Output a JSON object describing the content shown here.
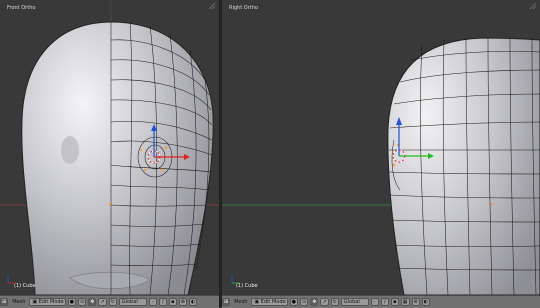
{
  "left_viewport": {
    "view_label": "Front Ortho",
    "object_label": "(1) Cube"
  },
  "right_viewport": {
    "view_label": "Right Ortho",
    "object_label": "(1) Cube"
  },
  "header": {
    "menu_mesh": "Mesh",
    "mode_selector": "Edit Mode",
    "orientation": "Global"
  },
  "colors": {
    "viewport_bg": "#393939",
    "header_bg": "#727272",
    "axis_x": "#e02020",
    "axis_y": "#22bb22",
    "axis_z": "#2050e0",
    "mesh_wire": "#111111",
    "selection": "#ff9a2a"
  },
  "icons": [
    "view-type-icon",
    "mode-icon",
    "shading-icon",
    "pivot-icon",
    "manipulator-icon",
    "layers-icon",
    "lock-icon",
    "render-icon"
  ]
}
